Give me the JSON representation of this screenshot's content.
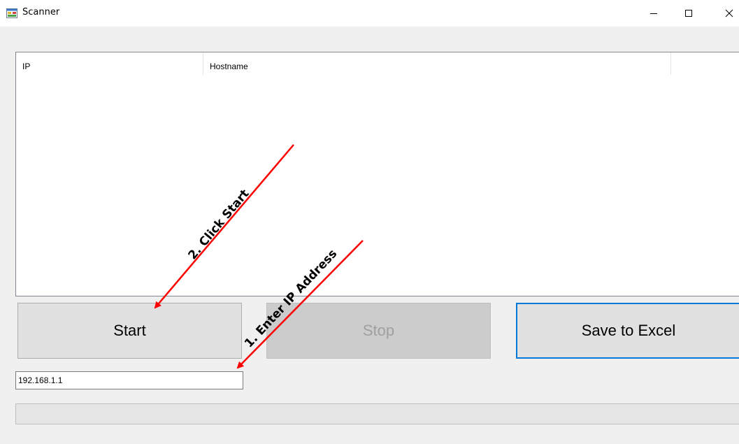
{
  "window": {
    "title": "Scanner",
    "icon": "windows-form-icon"
  },
  "caption_buttons": {
    "minimize_icon": "minimize-icon",
    "maximize_icon": "maximize-icon",
    "close_icon": "close-icon"
  },
  "listview": {
    "columns": [
      "IP",
      "Hostname",
      ""
    ],
    "rows": []
  },
  "buttons": {
    "start_label": "Start",
    "stop_label": "Stop",
    "save_label": "Save to Excel"
  },
  "ip_input": {
    "value": "192.168.1.1"
  },
  "progress": {
    "value": 0
  },
  "annotations": {
    "step1": "1. Enter IP Address",
    "step2": "2.  Click Start",
    "arrow_color": "#ff0000"
  }
}
